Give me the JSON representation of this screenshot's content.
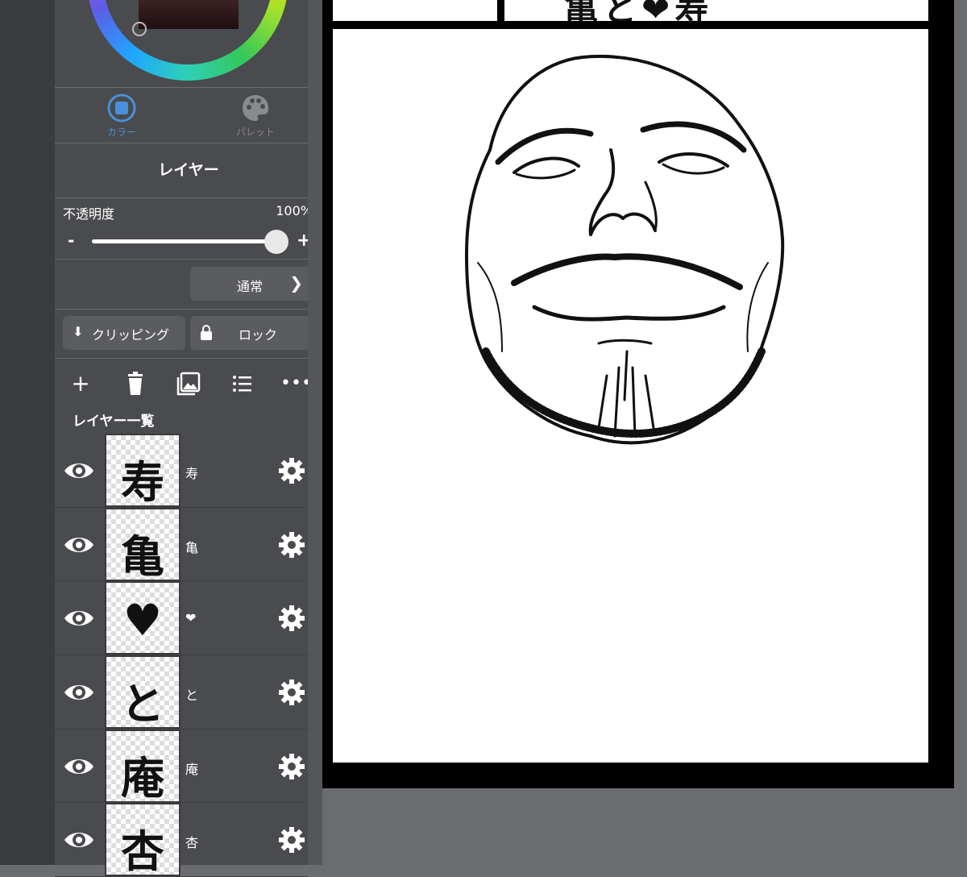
{
  "color_tabs": [
    {
      "label": "カラー",
      "icon": "color-icon",
      "active": true
    },
    {
      "label": "パレット",
      "icon": "palette-icon",
      "active": false
    }
  ],
  "layer_panel": {
    "title": "レイヤー",
    "opacity_label": "不透明度",
    "opacity_value": "100%",
    "opacity_fraction": 1.0,
    "minus": "-",
    "plus": "+",
    "blend_mode": "通常",
    "clipping_label": "クリッピング",
    "lock_label": "ロック",
    "list_title": "レイヤー一覧"
  },
  "layers": [
    {
      "name": "寿",
      "thumb": "寿"
    },
    {
      "name": "亀",
      "thumb": "亀"
    },
    {
      "name": "❤",
      "thumb": "♥"
    },
    {
      "name": "と",
      "thumb": "と"
    },
    {
      "name": "庵",
      "thumb": "庵"
    },
    {
      "name": "杏",
      "thumb": "杏"
    }
  ],
  "canvas": {
    "top_text": "亀と❤寿"
  },
  "colors": {
    "accent": "#4a90d9",
    "panel": "#4a4b4e",
    "canvas_bg": "#6b6c70"
  }
}
